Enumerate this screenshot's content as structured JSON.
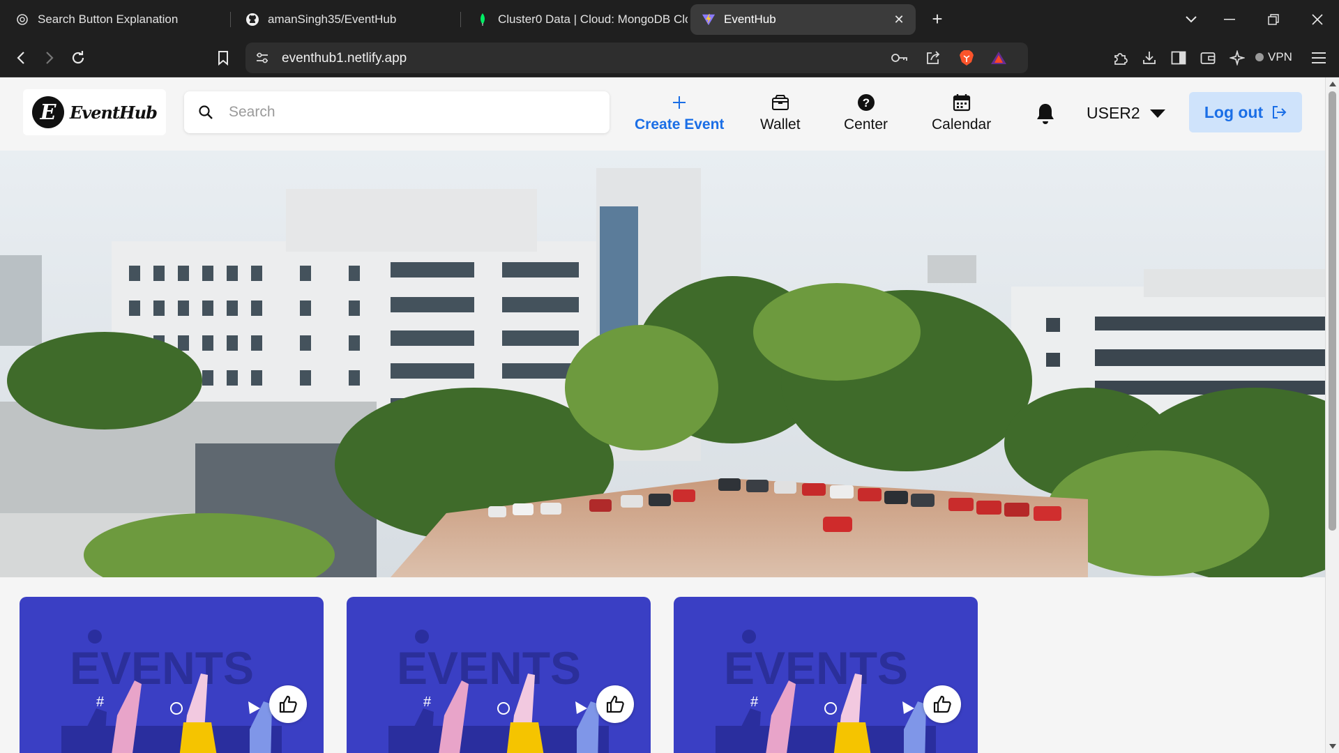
{
  "browser": {
    "tabs": [
      {
        "title": "Search Button Explanation",
        "favicon": "chatgpt-icon",
        "active": false
      },
      {
        "title": "amanSingh35/EventHub",
        "favicon": "github-icon",
        "active": false
      },
      {
        "title": "Cluster0 Data | Cloud: MongoDB Cloud",
        "favicon": "mongodb-leaf-icon",
        "active": false
      },
      {
        "title": "EventHub",
        "favicon": "vite-icon",
        "active": true
      }
    ],
    "url": "eventhub1.netlify.app",
    "vpn_label": "VPN",
    "accent_colors": {
      "mongodb": "#00ed64",
      "brave": "#fb542b"
    }
  },
  "app": {
    "logo_text": "EventHub",
    "logo_mark": "E",
    "search": {
      "placeholder": "Search",
      "value": ""
    },
    "nav": {
      "create_event": "Create Event",
      "wallet": "Wallet",
      "center": "Center",
      "calendar": "Calendar"
    },
    "user": {
      "name": "USER2"
    },
    "logout_label": "Log out",
    "colors": {
      "primary": "#1a6ee6",
      "logout_bg": "#cfe3fb",
      "card_bg": "#3a3fc4"
    }
  },
  "hero": {
    "image": "campus-building-photo"
  },
  "event_cards": [
    {
      "image": "events-banner-illustration",
      "art_text": "EVENTS",
      "liked": false
    },
    {
      "image": "events-banner-illustration",
      "art_text": "EVENTS",
      "liked": false
    },
    {
      "image": "events-banner-illustration",
      "art_text": "EVENTS",
      "liked": false
    }
  ]
}
